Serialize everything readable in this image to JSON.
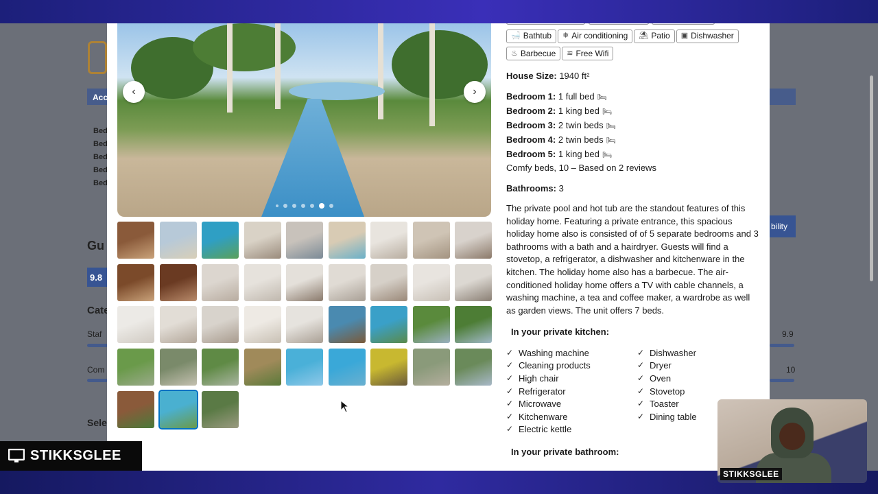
{
  "tags": [
    {
      "icon": "bathtub-icon",
      "glyph": "🛁",
      "label": "Bathtub"
    },
    {
      "icon": "snowflake-icon",
      "glyph": "❄",
      "label": "Air conditioning"
    },
    {
      "icon": "patio-icon",
      "glyph": "⛱",
      "label": "Patio"
    },
    {
      "icon": "dishwasher-icon",
      "glyph": "▣",
      "label": "Dishwasher"
    },
    {
      "icon": "barbecue-icon",
      "glyph": "♨",
      "label": "Barbecue"
    },
    {
      "icon": "wifi-icon",
      "glyph": "≋",
      "label": "Free Wifi"
    }
  ],
  "house_size": {
    "label": "House Size:",
    "value": "1940 ft²"
  },
  "bedrooms": [
    {
      "label": "Bedroom 1:",
      "value": "1 full bed"
    },
    {
      "label": "Bedroom 2:",
      "value": "1 king bed"
    },
    {
      "label": "Bedroom 3:",
      "value": "2 twin beds"
    },
    {
      "label": "Bedroom 4:",
      "value": "2 twin beds"
    },
    {
      "label": "Bedroom 5:",
      "value": "1 king bed"
    }
  ],
  "comfy": "Comfy beds, 10 – Based on 2 reviews",
  "bathrooms": {
    "label": "Bathrooms:",
    "value": "3"
  },
  "description": "The private pool and hot tub are the standout features of this holiday home. Featuring a private entrance, this spacious holiday home also is consisted of of 5 separate bedrooms and 3 bathrooms with a bath and a hairdryer. Guests will find a stovetop, a refrigerator, a dishwasher and kitchenware in the kitchen. The holiday home also has a barbecue. The air-conditioned holiday home offers a TV with cable channels, a washing machine, a tea and coffee maker, a wardrobe as well as garden views. The unit offers 7 beds.",
  "kitchen": {
    "heading": "In your private kitchen:",
    "col1": [
      "Washing machine",
      "Cleaning products",
      "High chair",
      "Refrigerator",
      "Microwave",
      "Kitchenware",
      "Electric kettle"
    ],
    "col2": [
      "Dishwasher",
      "Dryer",
      "Oven",
      "Stovetop",
      "Toaster",
      "Dining table"
    ]
  },
  "bathroom": {
    "heading": "In your private bathroom:"
  },
  "gallery": {
    "dots": 7,
    "active_dot": 6,
    "thumb_count": 39,
    "selected_thumb": 37
  },
  "background_page": {
    "partial_labels": [
      "Acc",
      "Gu",
      "9.8",
      "Cate",
      "Staf",
      "Com",
      "Sele",
      "bility",
      "9.9",
      "10"
    ]
  },
  "streamer": {
    "name": "STIKKSGLEE",
    "webcam_label": "STIKKSGLEE"
  }
}
